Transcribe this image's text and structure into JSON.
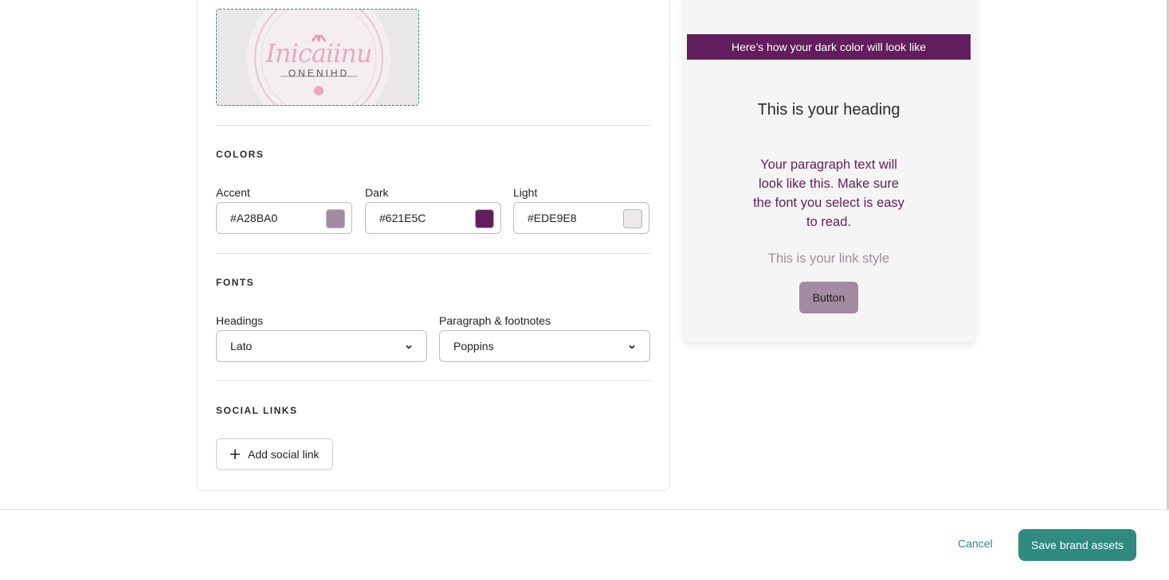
{
  "logo": {
    "script_text": "Inicaiinu",
    "sub_text": "ONENIHD"
  },
  "colors": {
    "section_title": "COLORS",
    "accent": {
      "label": "Accent",
      "value": "#A28BA0"
    },
    "dark": {
      "label": "Dark",
      "value": "#621E5C"
    },
    "light": {
      "label": "Light",
      "value": "#EDE9E8"
    }
  },
  "fonts": {
    "section_title": "FONTS",
    "headings": {
      "label": "Headings",
      "value": "Lato"
    },
    "paragraph": {
      "label": "Paragraph & footnotes",
      "value": "Poppins"
    }
  },
  "social": {
    "section_title": "SOCIAL LINKS",
    "add_label": "Add social link"
  },
  "preview": {
    "banner": "Here’s how your dark color will look like",
    "heading": "This is your heading",
    "paragraph": "Your paragraph text will look like this. Make sure the font you select is easy to read.",
    "link": "This is your link style",
    "button": "Button"
  },
  "footer": {
    "cancel_label": "Cancel",
    "save_label": "Save brand assets"
  }
}
